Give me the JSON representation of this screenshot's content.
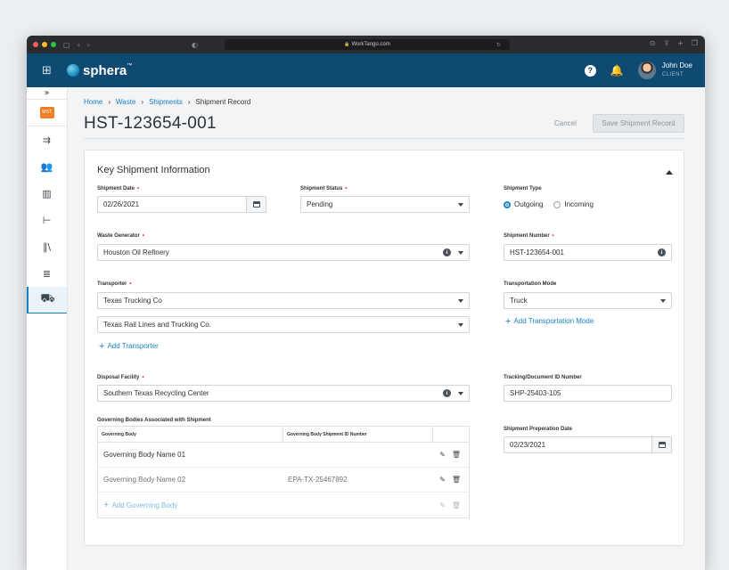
{
  "browser": {
    "url": "WorkTango.com"
  },
  "app": {
    "logo_text": "sphera",
    "logo_tm": "™"
  },
  "user": {
    "name": "John Doe",
    "role": "CLIENT"
  },
  "sidebar": {
    "badge": "WST"
  },
  "breadcrumb": {
    "items": [
      "Home",
      "Waste",
      "Shipments",
      "Shipment Record"
    ]
  },
  "page": {
    "title": "HST-123654-001",
    "cancel_label": "Cancel",
    "save_label": "Save Shipment Record"
  },
  "card": {
    "title": "Key Shipment Information"
  },
  "fields": {
    "shipment_date": {
      "label": "Shipment Date",
      "value": "02/26/2021"
    },
    "shipment_status": {
      "label": "Shipment Status",
      "value": "Pending"
    },
    "shipment_type": {
      "label": "Shipment Type",
      "options": [
        "Outgoing",
        "Incoming"
      ],
      "selected": "Outgoing"
    },
    "waste_generator": {
      "label": "Waste Generator",
      "value": "Houston Oil Refinery"
    },
    "shipment_number": {
      "label": "Shipment Number",
      "value": "HST-123654-001"
    },
    "transporter": {
      "label": "Transporter",
      "values": [
        "Texas Trucking Co",
        "Texas Rail Lines and Trucking Co."
      ],
      "add_label": "Add Transporter"
    },
    "transportation_mode": {
      "label": "Transportation Mode",
      "value": "Truck",
      "add_label": "Add Transportation Mode"
    },
    "disposal_facility": {
      "label": "Disposal Facility",
      "value": "Southern Texas Recycling Center"
    },
    "tracking_id": {
      "label": "Tracking/Document ID Number",
      "value": "SHP-25403-105"
    },
    "prep_date": {
      "label": "Shipment Preperation Date",
      "value": "02/23/2021"
    }
  },
  "governing": {
    "label": "Governing Bodies Associated with Shipment",
    "headers": [
      "Governing Body",
      "Governing Body Shipment ID Number"
    ],
    "rows": [
      {
        "name": "Governing Body Name 01",
        "id": ""
      },
      {
        "name": "Governing Body Name 02",
        "id": "EPA-TX-25467892"
      }
    ],
    "add_label": "Add Governing Body"
  },
  "colors": {
    "primary": "#1a82c4",
    "header": "#0e4a72",
    "required": "#e0322f",
    "badge": "#f07f24"
  }
}
